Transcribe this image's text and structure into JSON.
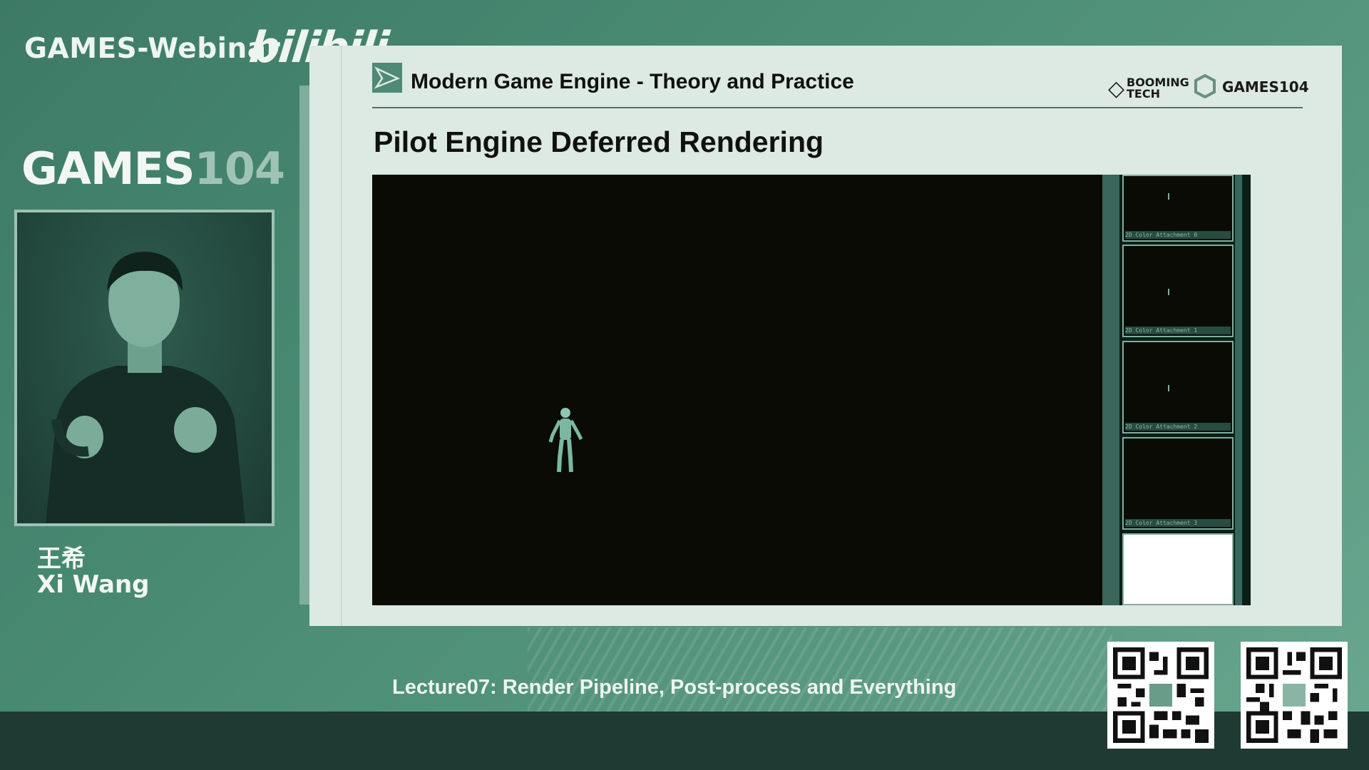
{
  "overlay": {
    "brand": "GAMES-Webinar",
    "site_logo": "bilibili",
    "course_logo_bold": "GAMES",
    "course_logo_number": "104",
    "speaker_cn": "王希",
    "speaker_en": "Xi Wang",
    "lecture": "Lecture07: Render Pipeline, Post-process and Everything"
  },
  "slide": {
    "header_title": "Modern Game Engine - Theory and Practice",
    "title": "Pilot Engine Deferred Rendering",
    "logo_booming_1": "BOOMING",
    "logo_booming_2": "TECH",
    "logo_games104": "GAMES104",
    "attachments": [
      {
        "caption": "2D Color Attachment 0"
      },
      {
        "caption": "2D Color Attachment 1"
      },
      {
        "caption": "2D Color Attachment 2"
      },
      {
        "caption": "2D Color Attachment 3"
      },
      {
        "caption": ""
      }
    ]
  },
  "icons": [
    "slide-logo-icon",
    "booming-tech-icon",
    "games104-icon",
    "qr-code-icon"
  ],
  "colors": {
    "background": "#4a8c74",
    "slide_bg": "#dde9e3",
    "viewport_bg": "#0a0b05",
    "bottom_band": "#1f3a33"
  }
}
